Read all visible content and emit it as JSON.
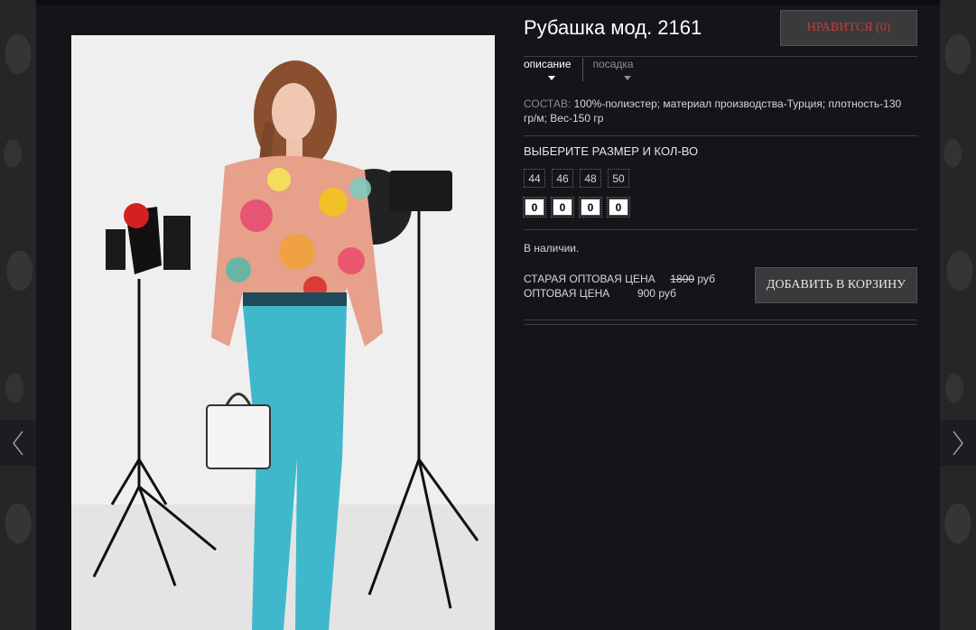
{
  "product": {
    "title": "Рубашка мод. 2161",
    "like_button": "НРАВИТСЯ (0)",
    "photo_icon": "model-photo"
  },
  "tabs": [
    {
      "label": "описание",
      "active": true
    },
    {
      "label": "посадка",
      "active": false
    }
  ],
  "composition": {
    "label": "СОСТАВ:",
    "text": "100%-полиэстер; материал производства-Турция; плотность-130 гр/м; Вес-150 гр"
  },
  "sizes": {
    "title": "ВЫБЕРИТЕ РАЗМЕР И КОЛ-ВО",
    "values": [
      "44",
      "46",
      "48",
      "50"
    ],
    "quantities": [
      "0",
      "0",
      "0",
      "0"
    ]
  },
  "stock_status": "В наличии.",
  "pricing": {
    "old_label": "СТАРАЯ ОПТОВАЯ ЦЕНА",
    "old_value": "1800",
    "old_currency": "руб",
    "label": "ОПТОВАЯ ЦЕНА",
    "value": "900",
    "currency": "руб"
  },
  "cart_button": "ДОБАВИТЬ В КОРЗИНУ",
  "nav": {
    "prev_icon": "chevron-left-icon",
    "next_icon": "chevron-right-icon"
  },
  "colors": {
    "background": "#151419",
    "like_text": "#c8393a",
    "button_bg": "#3a3a3c"
  }
}
